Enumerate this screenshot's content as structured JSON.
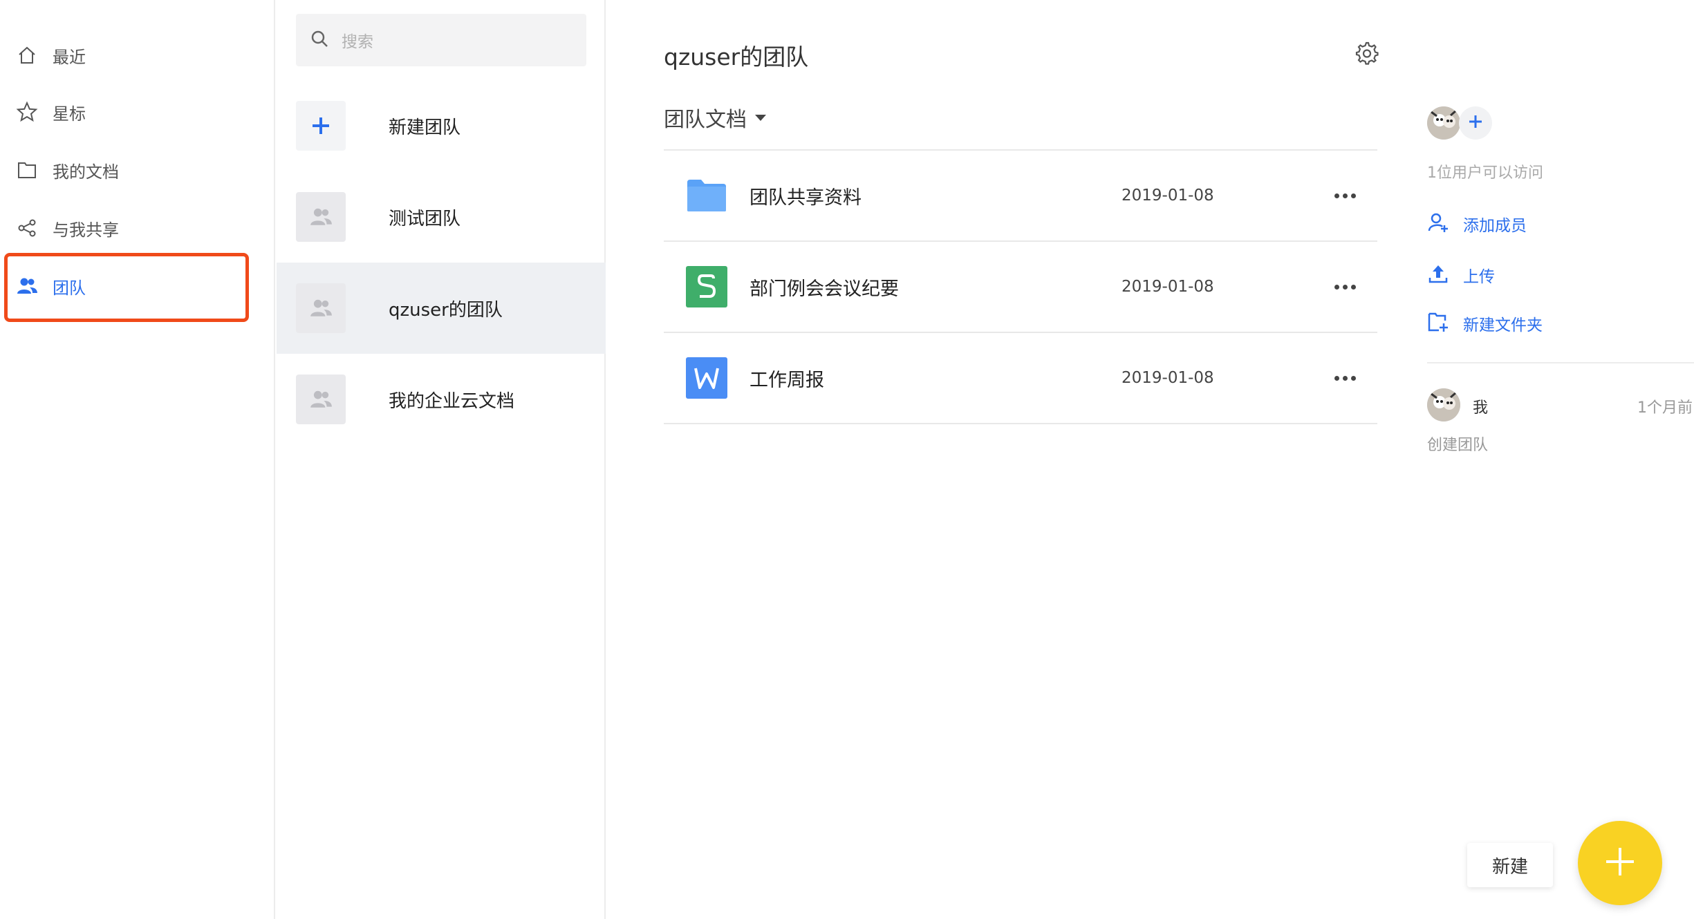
{
  "nav": {
    "items": [
      {
        "label": "最近",
        "icon": "home-icon"
      },
      {
        "label": "星标",
        "icon": "star-icon"
      },
      {
        "label": "我的文档",
        "icon": "folder-icon"
      },
      {
        "label": "与我共享",
        "icon": "share-icon"
      },
      {
        "label": "团队",
        "icon": "team-icon",
        "active": true
      }
    ]
  },
  "teams": {
    "search_placeholder": "搜索",
    "new_team_label": "新建团队",
    "items": [
      {
        "label": "测试团队"
      },
      {
        "label": "qzuser的团队",
        "selected": true
      },
      {
        "label": "我的企业云文档"
      }
    ]
  },
  "main": {
    "team_title": "qzuser的团队",
    "section_title": "团队文档",
    "files": [
      {
        "name": "团队共享资料",
        "date": "2019-01-08",
        "type": "folder"
      },
      {
        "name": "部门例会会议纪要",
        "date": "2019-01-08",
        "type": "sheet"
      },
      {
        "name": "工作周报",
        "date": "2019-01-08",
        "type": "doc"
      }
    ]
  },
  "side": {
    "access_text": "1位用户可以访问",
    "actions": [
      {
        "label": "添加成员",
        "icon": "add-user-icon"
      },
      {
        "label": "上传",
        "icon": "upload-icon"
      },
      {
        "label": "新建文件夹",
        "icon": "new-folder-icon"
      }
    ],
    "activity": {
      "user": "我",
      "time": "1个月前",
      "desc": "创建团队"
    }
  },
  "fab": {
    "label": "新建"
  },
  "colors": {
    "accent": "#2c6fec",
    "highlight": "#f04a1a",
    "fab": "#f9d223",
    "sheet": "#3fae6a",
    "doc": "#4a8df5",
    "folder": "#5aa2f7"
  }
}
